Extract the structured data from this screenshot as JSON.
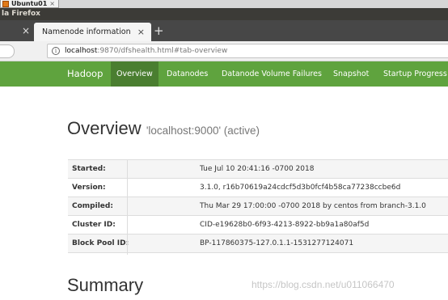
{
  "vm": {
    "tab_label": "Ubuntu01",
    "close_glyph": "×"
  },
  "window": {
    "title": "la Firefox"
  },
  "tabs": {
    "left_close_glyph": "×",
    "active_title": "Namenode information",
    "active_close_glyph": "×",
    "new_tab_glyph": "+"
  },
  "url": {
    "host": "localhost",
    "rest": ":9870/dfshealth.html#tab-overview",
    "info_glyph": "i"
  },
  "hadoop_nav": {
    "brand": "Hadoop",
    "items": [
      "Overview",
      "Datanodes",
      "Datanode Volume Failures",
      "Snapshot",
      "Startup Progress"
    ],
    "active": "Overview"
  },
  "overview": {
    "title": "Overview",
    "subtitle": "'localhost:9000' (active)"
  },
  "info_rows": [
    {
      "key": "Started:",
      "value": "Tue Jul 10 20:41:16 -0700 2018"
    },
    {
      "key": "Version:",
      "value": "3.1.0, r16b70619a24cdcf5d3b0fcf4b58ca77238ccbe6d"
    },
    {
      "key": "Compiled:",
      "value": "Thu Mar 29 17:00:00 -0700 2018 by centos from branch-3.1.0"
    },
    {
      "key": "Cluster ID:",
      "value": "CID-e19628b0-6f93-4213-8922-bb9a1a80af5d"
    },
    {
      "key": "Block Pool ID:",
      "value": "BP-117860375-127.0.1.1-1531277124071"
    }
  ],
  "summary": {
    "title": "Summary"
  },
  "watermark": "https://blog.csdn.net/u011066470",
  "colors": {
    "hadoop_green": "#5fa33e",
    "active_nav": "#4a7e30",
    "title_bar": "#3c3b37"
  }
}
